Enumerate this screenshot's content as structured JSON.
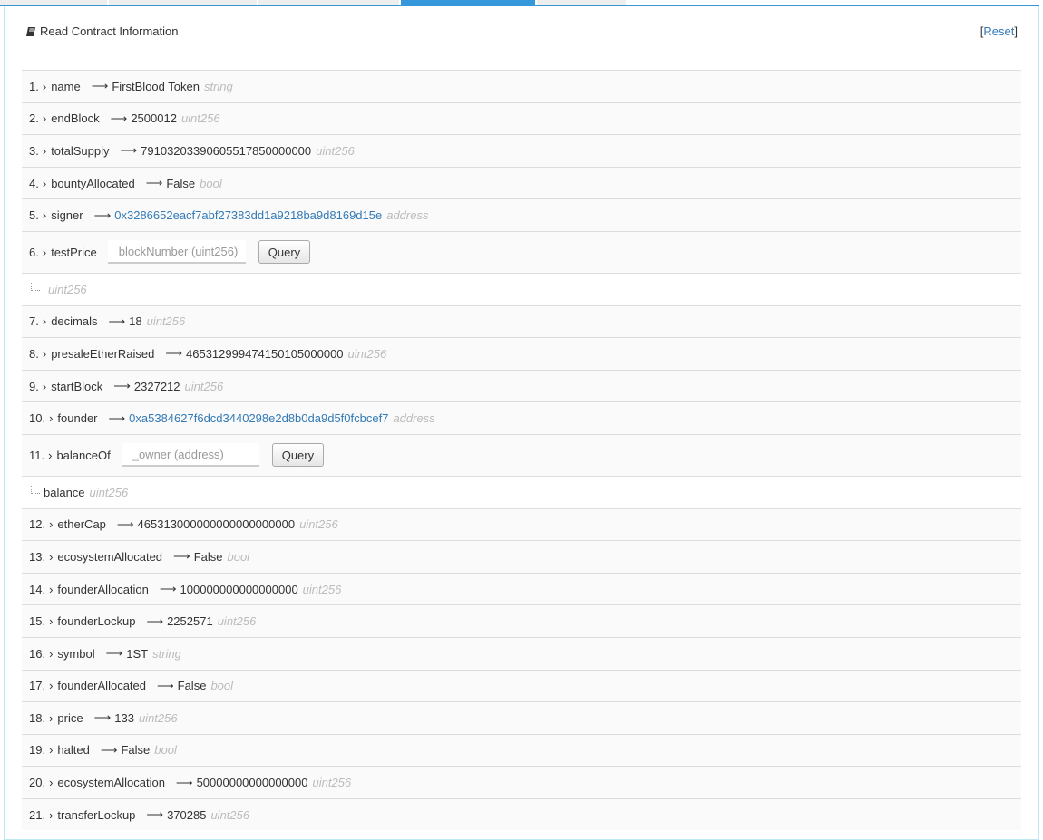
{
  "tabs": [
    {
      "active": false
    },
    {
      "active": false
    },
    {
      "active": false
    },
    {
      "active": true
    },
    {
      "active": false
    }
  ],
  "accent": "#3498db",
  "header": {
    "title": "Read Contract Information",
    "icon": "book-icon",
    "reset_label": "Reset"
  },
  "rows": [
    {
      "n": "1.",
      "name": "name",
      "value": "FirstBlood Token",
      "type": "string"
    },
    {
      "n": "2.",
      "name": "endBlock",
      "value": "2500012",
      "type": "uint256"
    },
    {
      "n": "3.",
      "name": "totalSupply",
      "value": "79103203390605517850000000",
      "type": "uint256"
    },
    {
      "n": "4.",
      "name": "bountyAllocated",
      "value": "False",
      "type": "bool"
    },
    {
      "n": "5.",
      "name": "signer",
      "value": "0x3286652eacf7abf27383dd1a9218ba9d8169d15e",
      "type": "address",
      "link": true
    },
    {
      "n": "6.",
      "name": "testPrice",
      "input_placeholder": "blockNumber (uint256)",
      "button": "Query",
      "output_name": "",
      "output_type": "uint256"
    },
    {
      "n": "7.",
      "name": "decimals",
      "value": "18",
      "type": "uint256"
    },
    {
      "n": "8.",
      "name": "presaleEtherRaised",
      "value": "465312999474150105000000",
      "type": "uint256"
    },
    {
      "n": "9.",
      "name": "startBlock",
      "value": "2327212",
      "type": "uint256"
    },
    {
      "n": "10.",
      "name": "founder",
      "value": "0xa5384627f6dcd3440298e2d8b0da9d5f0fcbcef7",
      "type": "address",
      "link": true
    },
    {
      "n": "11.",
      "name": "balanceOf",
      "input_placeholder": "_owner (address)",
      "button": "Query",
      "output_name": "balance",
      "output_type": "uint256"
    },
    {
      "n": "12.",
      "name": "etherCap",
      "value": "465313000000000000000000",
      "type": "uint256"
    },
    {
      "n": "13.",
      "name": "ecosystemAllocated",
      "value": "False",
      "type": "bool"
    },
    {
      "n": "14.",
      "name": "founderAllocation",
      "value": "100000000000000000",
      "type": "uint256"
    },
    {
      "n": "15.",
      "name": "founderLockup",
      "value": "2252571",
      "type": "uint256"
    },
    {
      "n": "16.",
      "name": "symbol",
      "value": "1ST",
      "type": "string"
    },
    {
      "n": "17.",
      "name": "founderAllocated",
      "value": "False",
      "type": "bool"
    },
    {
      "n": "18.",
      "name": "price",
      "value": "133",
      "type": "uint256"
    },
    {
      "n": "19.",
      "name": "halted",
      "value": "False",
      "type": "bool"
    },
    {
      "n": "20.",
      "name": "ecosystemAllocation",
      "value": "50000000000000000",
      "type": "uint256"
    },
    {
      "n": "21.",
      "name": "transferLockup",
      "value": "370285",
      "type": "uint256"
    }
  ]
}
